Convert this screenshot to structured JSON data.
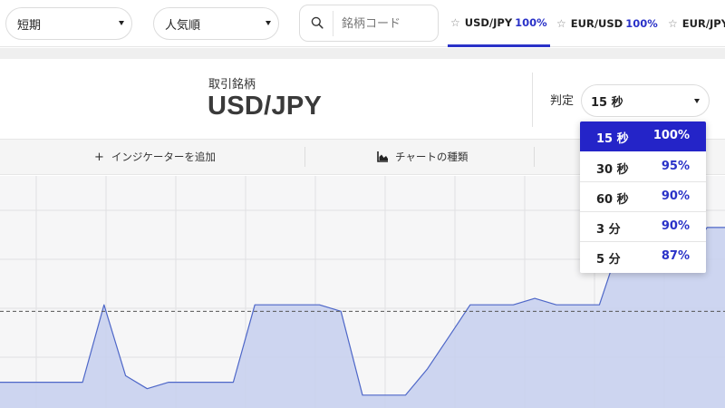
{
  "filters": {
    "term": "短期",
    "sort": "人気順"
  },
  "search": {
    "placeholder": "銘柄コード"
  },
  "pair_tabs": [
    {
      "name": "USD/JPY",
      "payout": "100%",
      "active": true
    },
    {
      "name": "EUR/USD",
      "payout": "100%",
      "active": false
    },
    {
      "name": "EUR/JPY",
      "payout": "",
      "active": false
    }
  ],
  "symbol": {
    "label": "取引銘柄",
    "value": "USD/JPY"
  },
  "judgement": {
    "label": "判定",
    "selected": "15 秒"
  },
  "toolbar": {
    "add_indicator": "インジケーターを追加",
    "chart_type": "チャートの種類"
  },
  "duration_options": [
    {
      "time": "15 秒",
      "payout": "100%",
      "selected": true
    },
    {
      "time": "30 秒",
      "payout": "95%",
      "selected": false
    },
    {
      "time": "60 秒",
      "payout": "90%",
      "selected": false
    },
    {
      "time": "3 分",
      "payout": "90%",
      "selected": false
    },
    {
      "time": "5 分",
      "payout": "87%",
      "selected": false
    }
  ],
  "colors": {
    "accent": "#2a32c8",
    "chart_fill": "#c5cfee",
    "chart_line": "#4e67c8"
  },
  "chart_data": {
    "type": "area",
    "x": [
      0,
      1,
      2,
      3,
      4,
      5,
      6,
      7,
      8,
      9,
      10,
      11,
      12,
      13,
      14,
      15,
      16,
      17,
      18,
      19,
      20,
      21,
      22,
      23,
      24,
      25,
      26,
      27,
      28,
      29,
      30,
      31,
      32,
      33,
      34
    ],
    "y": [
      18,
      18,
      18,
      18,
      18,
      30,
      19,
      17,
      18,
      18,
      18,
      18,
      30,
      30,
      30,
      30,
      29,
      16,
      16,
      16,
      20,
      25,
      30,
      30,
      30,
      31,
      30,
      30,
      30,
      40,
      42,
      37,
      37,
      42,
      42
    ],
    "reference_line": 29,
    "ylim": [
      14,
      50
    ],
    "grid": true
  }
}
